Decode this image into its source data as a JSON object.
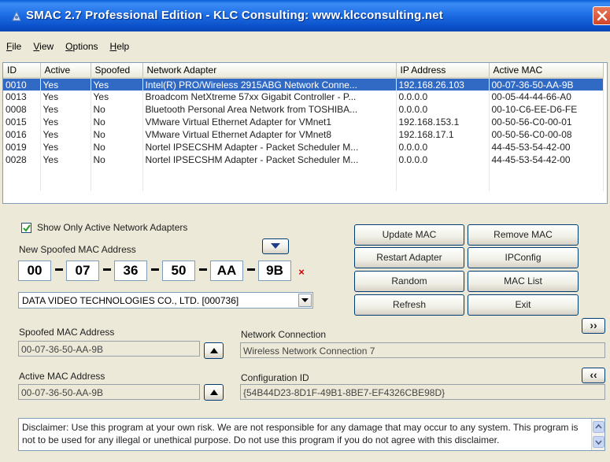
{
  "window": {
    "title": "SMAC 2.7  Professional Edition  -  KLC Consulting:  www.klcconsulting.net"
  },
  "menu": [
    {
      "label": "File",
      "accel": "F",
      "rest": "ile"
    },
    {
      "label": "View",
      "accel": "V",
      "rest": "iew"
    },
    {
      "label": "Options",
      "accel": "O",
      "rest": "ptions"
    },
    {
      "label": "Help",
      "accel": "H",
      "rest": "elp"
    }
  ],
  "adapters": {
    "columns": [
      "ID",
      "Active",
      "Spoofed",
      "Network Adapter",
      "IP Address",
      "Active MAC"
    ],
    "rows": [
      {
        "id": "0010",
        "active": "Yes",
        "spoofed": "Yes",
        "adapter": "Intel(R) PRO/Wireless 2915ABG Network Conne...",
        "ip": "192.168.26.103",
        "mac": "00-07-36-50-AA-9B",
        "selected": true
      },
      {
        "id": "0013",
        "active": "Yes",
        "spoofed": "Yes",
        "adapter": "Broadcom NetXtreme 57xx Gigabit Controller - P...",
        "ip": "0.0.0.0",
        "mac": "00-05-44-44-66-A0"
      },
      {
        "id": "0008",
        "active": "Yes",
        "spoofed": "No",
        "adapter": "Bluetooth Personal Area Network from TOSHIBA...",
        "ip": "0.0.0.0",
        "mac": "00-10-C6-EE-D6-FE"
      },
      {
        "id": "0015",
        "active": "Yes",
        "spoofed": "No",
        "adapter": "VMware Virtual Ethernet Adapter for VMnet1",
        "ip": "192.168.153.1",
        "mac": "00-50-56-C0-00-01"
      },
      {
        "id": "0016",
        "active": "Yes",
        "spoofed": "No",
        "adapter": "VMware Virtual Ethernet Adapter for VMnet8",
        "ip": "192.168.17.1",
        "mac": "00-50-56-C0-00-08"
      },
      {
        "id": "0019",
        "active": "Yes",
        "spoofed": "No",
        "adapter": "Nortel IPSECSHM Adapter - Packet Scheduler M...",
        "ip": "0.0.0.0",
        "mac": "44-45-53-54-42-00"
      },
      {
        "id": "0028",
        "active": "Yes",
        "spoofed": "No",
        "adapter": "Nortel IPSECSHM Adapter - Packet Scheduler M...",
        "ip": "0.0.0.0",
        "mac": "44-45-53-54-42-00"
      }
    ]
  },
  "show_only_active": {
    "label": "Show Only Active Network Adapters",
    "checked": true
  },
  "new_mac": {
    "label": "New Spoofed MAC Address",
    "octets": [
      "00",
      "07",
      "36",
      "50",
      "AA",
      "9B"
    ],
    "clear_symbol": "×"
  },
  "vendor_select": {
    "value": "DATA VIDEO TECHNOLOGIES CO., LTD. [000736]"
  },
  "buttons": {
    "update_mac": "Update MAC",
    "remove_mac": "Remove MAC",
    "restart_adapter": "Restart Adapter",
    "ipconfig": "IPConfig",
    "random": "Random",
    "mac_list": "MAC List",
    "refresh": "Refresh",
    "exit": "Exit",
    "expand": "››",
    "collapse": "‹‹"
  },
  "spoofed_mac": {
    "label": "Spoofed MAC Address",
    "value": "00-07-36-50-AA-9B"
  },
  "active_mac": {
    "label": "Active MAC Address",
    "value": "00-07-36-50-AA-9B"
  },
  "network_connection": {
    "label": "Network Connection",
    "value": "Wireless Network Connection 7"
  },
  "configuration_id": {
    "label": "Configuration ID",
    "value": "{54B44D23-8D1F-49B1-8BE7-EF4326CBE98D}"
  },
  "disclaimer": "Disclaimer: Use this program at your own risk.  We are not responsible for any damage that may occur to any system.  This program is not to be used for any illegal or unethical purpose.  Do not use this program if you do not agree with this disclaimer.",
  "colors": {
    "title_bar": "#1f6fe6",
    "selection": "#316ac5",
    "dialog_bg": "#ece9d8",
    "clear_x": "#cc0000"
  }
}
